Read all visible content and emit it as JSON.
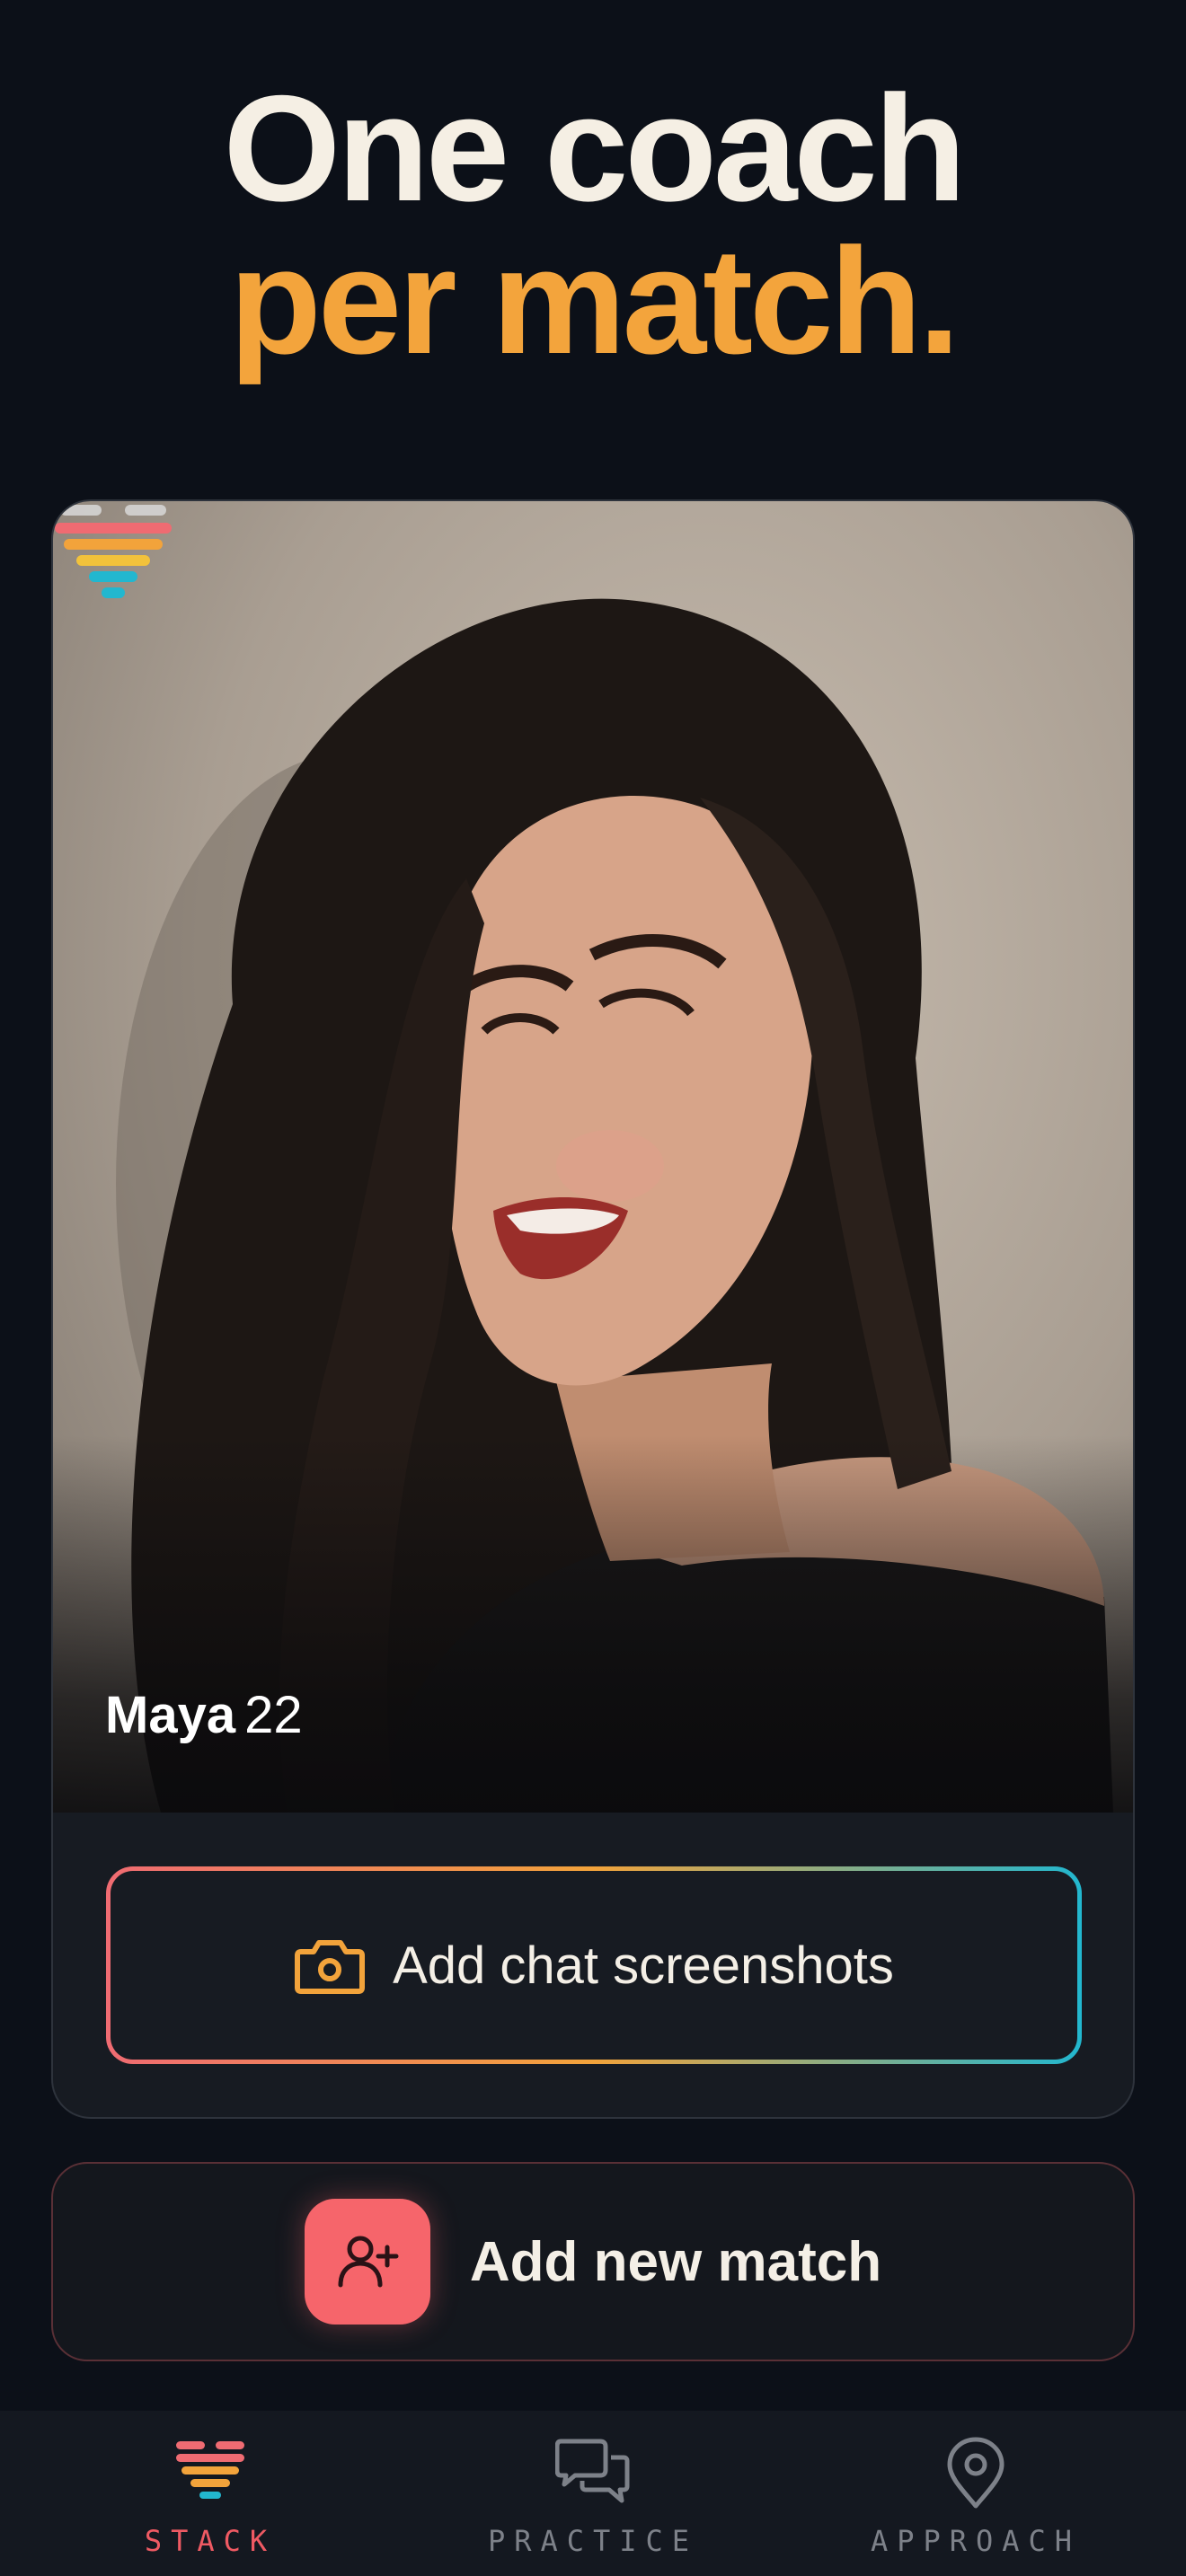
{
  "headline": {
    "line1": "One coach",
    "line2": "per match."
  },
  "match_card": {
    "name": "Maya",
    "age": "22",
    "photo": "illustrated-portrait",
    "add_screenshots_label": "Add chat screenshots",
    "add_screenshots_icon": "camera-icon"
  },
  "add_match": {
    "label": "Add new match",
    "icon": "add-user-icon"
  },
  "tabbar": {
    "items": [
      {
        "label": "STACK",
        "icon": "stack-heart-icon",
        "active": true
      },
      {
        "label": "PRACTICE",
        "icon": "chat-bubbles-icon",
        "active": false
      },
      {
        "label": "APPROACH",
        "icon": "location-pin-icon",
        "active": false
      }
    ]
  },
  "colors": {
    "background": "#0c1018",
    "accent_orange": "#f3a43c",
    "accent_coral": "#f6656b",
    "accent_cyan": "#22b7cf",
    "text_light": "#f5efe4"
  }
}
